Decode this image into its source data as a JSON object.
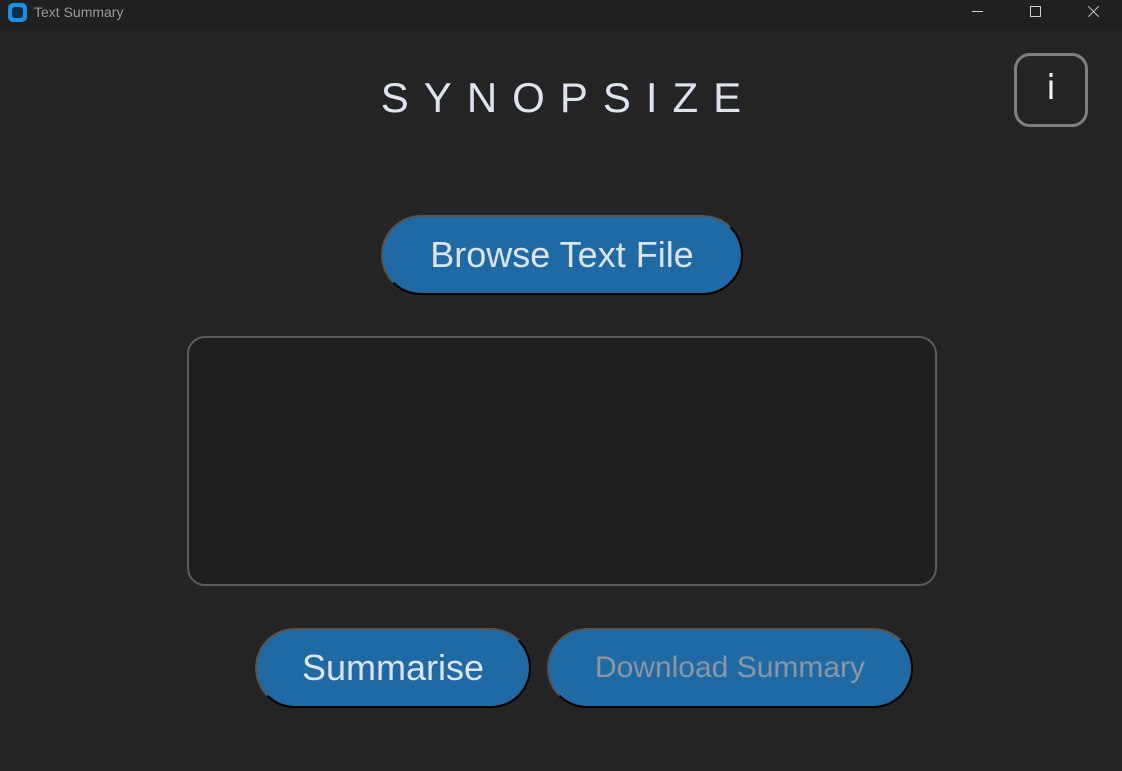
{
  "window": {
    "title": "Text Summary",
    "controls": {
      "minimize": "minimize",
      "maximize": "maximize",
      "close": "close"
    }
  },
  "app": {
    "heading": "SYNOPSIZE",
    "info_label": "i",
    "browse_label": "Browse Text File",
    "text_area_value": "",
    "summarise_label": "Summarise",
    "download_label": "Download Summary"
  },
  "colors": {
    "background": "#242424",
    "accent": "#1f6aa5",
    "text": "#dde4f0",
    "disabled_text": "#8b96a3"
  }
}
